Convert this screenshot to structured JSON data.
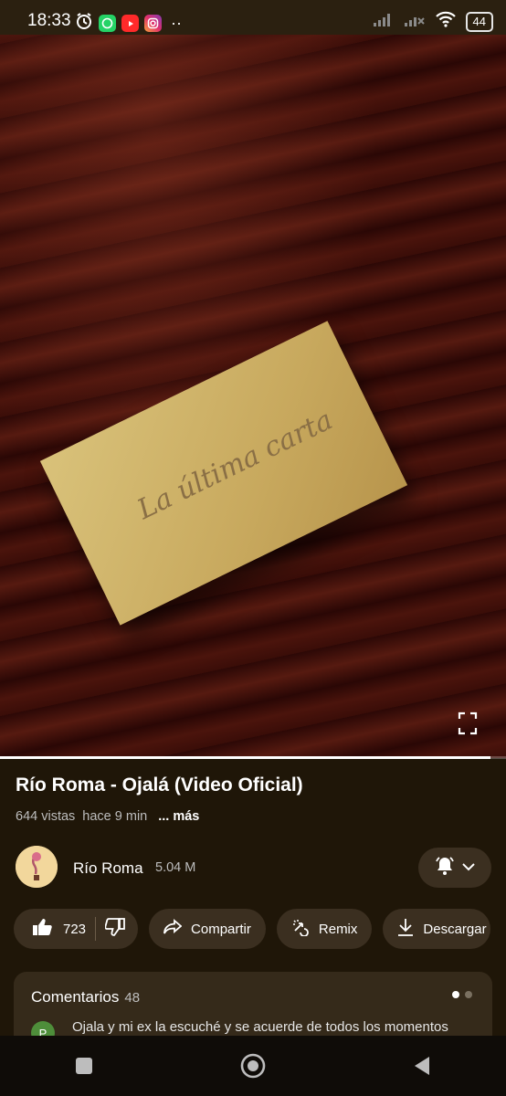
{
  "status_bar": {
    "time": "18:33",
    "battery": "44",
    "icons": [
      "alarm-icon",
      "whatsapp-icon",
      "youtube-icon",
      "instagram-icon",
      "more-dots-icon",
      "signal-icon",
      "signal-2-icon",
      "wifi-icon",
      "battery-icon"
    ]
  },
  "video": {
    "envelope_text": "La última carta",
    "progress_fraction": 0.97
  },
  "details": {
    "title": "Río Roma - Ojalá (Video Oficial)",
    "views": "644 vistas",
    "time_ago": "hace 9 min",
    "more": "... más"
  },
  "channel": {
    "name": "Río Roma",
    "subscribers": "5.04 M"
  },
  "actions": {
    "like_count": "723",
    "share": "Compartir",
    "remix": "Remix",
    "download": "Descargar"
  },
  "comments": {
    "title": "Comentarios",
    "count": "48",
    "avatar_initial": "P",
    "first_comment": "Ojala y mi ex la escuché y se acuerde de todos los momentos"
  },
  "colors": {
    "bg": "#1f1608",
    "pill": "#3b2f20",
    "accent_green": "#25d366"
  }
}
